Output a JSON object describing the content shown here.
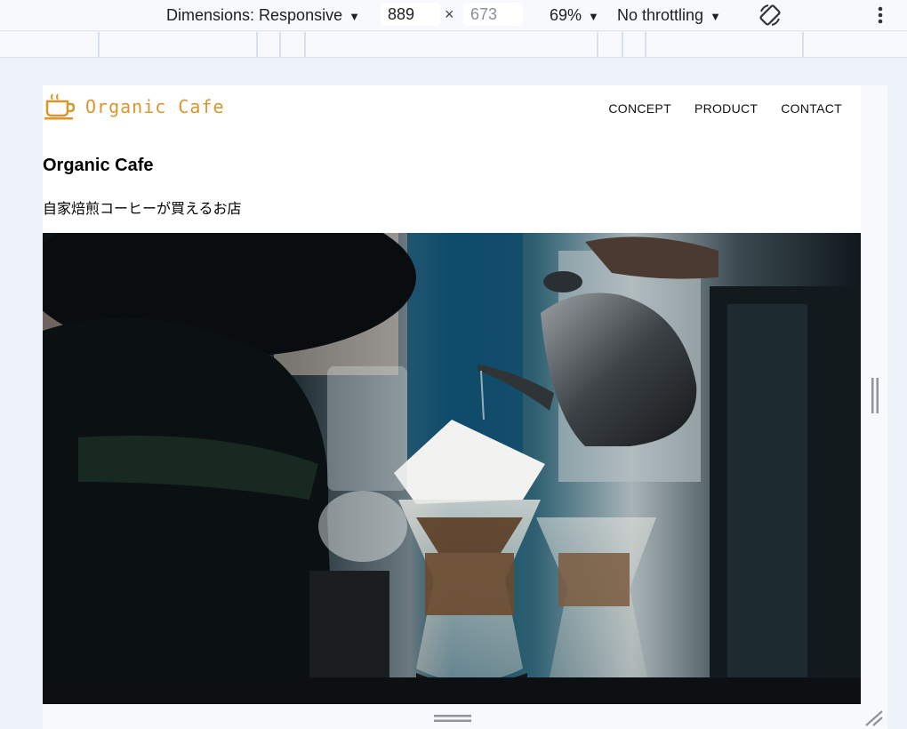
{
  "devtools": {
    "dimensions_label": "Dimensions: Responsive",
    "width_value": "889",
    "height_placeholder": "673",
    "times": "×",
    "zoom_label": "69%",
    "throttling_label": "No throttling",
    "icons": [
      "caret-down-icon",
      "rotate-icon",
      "more-vert-icon",
      "resize-handle-icon"
    ]
  },
  "site": {
    "logo_text": "Organic Cafe",
    "nav": [
      "CONCEPT",
      "PRODUCT",
      "CONTACT"
    ],
    "hero_title": "Organic Cafe",
    "hero_subtitle": "自家焙煎コーヒーが買えるお店",
    "accent_color": "#d9962d"
  }
}
